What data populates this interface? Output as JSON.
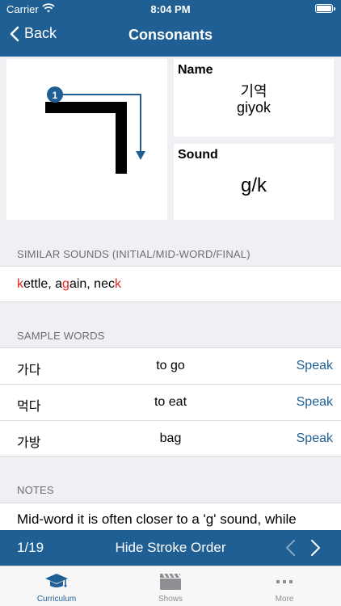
{
  "status_bar": {
    "carrier": "Carrier",
    "time": "8:04 PM"
  },
  "nav": {
    "back_label": "Back",
    "title": "Consonants"
  },
  "stroke_card": {
    "character": "ㄱ",
    "stroke_number": "1"
  },
  "name_card": {
    "label": "Name",
    "korean": "기역",
    "romanized": "giyok"
  },
  "sound_card": {
    "label": "Sound",
    "value": "g/k"
  },
  "similar_sounds": {
    "header": "SIMILAR SOUNDS (INITIAL/MID-WORD/FINAL)",
    "parts": [
      "k",
      "ettle, a",
      "g",
      "ain, nec",
      "k"
    ]
  },
  "sample_words": {
    "header": "SAMPLE WORDS",
    "speak_label": "Speak",
    "rows": [
      {
        "korean": "가다",
        "english": "to go"
      },
      {
        "korean": "먹다",
        "english": "to eat"
      },
      {
        "korean": "가방",
        "english": "bag"
      }
    ]
  },
  "notes": {
    "header": "NOTES",
    "text": "Mid-word it is often closer to a 'g' sound, while"
  },
  "bottom_bar": {
    "counter": "1/19",
    "toggle_label": "Hide Stroke Order"
  },
  "tabs": [
    {
      "label": "Curriculum",
      "icon": "graduation-cap-icon",
      "active": true
    },
    {
      "label": "Shows",
      "icon": "clapperboard-icon",
      "active": false
    },
    {
      "label": "More",
      "icon": "ellipsis-icon",
      "active": false
    }
  ],
  "colors": {
    "brand": "#1f5f93",
    "highlight": "#e8231f",
    "background": "#efeff4"
  }
}
